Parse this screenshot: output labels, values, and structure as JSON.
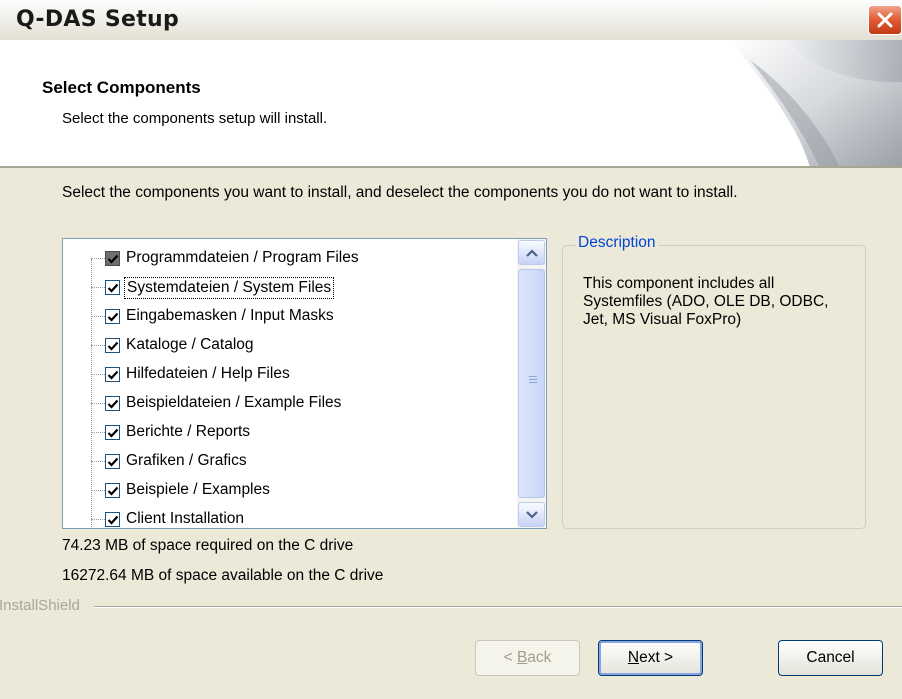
{
  "window": {
    "title": "Q-DAS Setup",
    "close_icon": "close-x-icon",
    "close_color": "#E05A33"
  },
  "header": {
    "title": "Select Components",
    "subtitle": "Select the components setup will install."
  },
  "intro": "Select the components you want to install, and deselect the components you do not want to install.",
  "components": [
    {
      "label": "Programmdateien / Program Files",
      "state": "checked-grey"
    },
    {
      "label": "Systemdateien / System Files",
      "state": "checked",
      "focused": true
    },
    {
      "label": "Eingabemasken / Input Masks",
      "state": "checked"
    },
    {
      "label": "Kataloge / Catalog",
      "state": "checked"
    },
    {
      "label": "Hilfedateien / Help Files",
      "state": "checked"
    },
    {
      "label": "Beispieldateien / Example Files",
      "state": "checked"
    },
    {
      "label": "Berichte / Reports",
      "state": "checked"
    },
    {
      "label": "Grafiken / Grafics",
      "state": "checked"
    },
    {
      "label": "Beispiele / Examples",
      "state": "checked"
    },
    {
      "label": "Client Installation",
      "state": "checked"
    }
  ],
  "description": {
    "legend": "Description",
    "text": "This component includes all Systemfiles (ADO, OLE DB, ODBC, Jet, MS Visual FoxPro)"
  },
  "space": {
    "required": "74.23 MB of space required on the C drive",
    "available": "16272.64 MB of space available on the C drive"
  },
  "brand": "InstallShield",
  "buttons": {
    "back_prefix": "< ",
    "back_key": "B",
    "back_rest": "ack",
    "next_key": "N",
    "next_rest": "ext >",
    "cancel": "Cancel"
  }
}
